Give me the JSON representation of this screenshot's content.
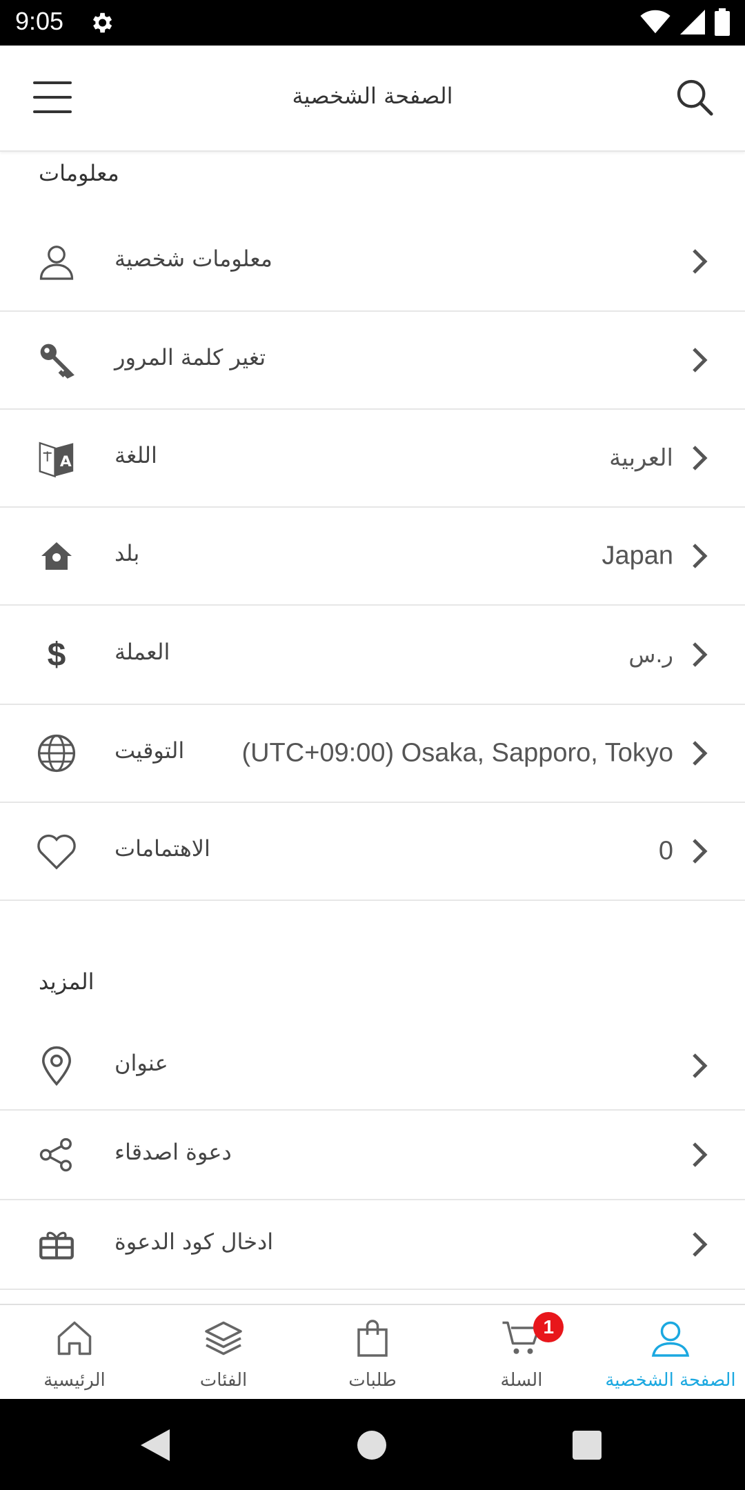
{
  "status": {
    "time": "9:05"
  },
  "header": {
    "title": "الصفحة الشخصية"
  },
  "sections": {
    "info_title": "معلومات",
    "more_title": "المزيد"
  },
  "info_items": [
    {
      "label": "معلومات شخصية",
      "value": "",
      "icon": "user-icon"
    },
    {
      "label": "تغير كلمة المرور",
      "value": "",
      "icon": "key-icon"
    },
    {
      "label": "اللغة",
      "value": "العربية",
      "icon": "translate-icon"
    },
    {
      "label": "بلد",
      "value": "Japan",
      "icon": "home-location-icon"
    },
    {
      "label": "العملة",
      "value": "ر.س",
      "icon": "dollar-icon"
    },
    {
      "label": "التوقيت",
      "value": "(UTC+09:00) Osaka, Sapporo, Tokyo",
      "icon": "globe-icon"
    },
    {
      "label": "الاهتمامات",
      "value": "0",
      "icon": "heart-icon"
    }
  ],
  "more_items": [
    {
      "label": "عنوان",
      "icon": "location-pin-icon"
    },
    {
      "label": "دعوة اصدقاء",
      "icon": "share-icon"
    },
    {
      "label": "ادخال كود الدعوة",
      "icon": "gift-icon"
    }
  ],
  "bottom_nav": [
    {
      "label": "الرئيسية",
      "icon": "home-icon"
    },
    {
      "label": "الفئات",
      "icon": "layers-icon"
    },
    {
      "label": "طلبات",
      "icon": "bag-icon"
    },
    {
      "label": "السلة",
      "icon": "cart-icon",
      "badge": "1"
    },
    {
      "label": "الصفحة الشخصية",
      "icon": "profile-icon",
      "active": true
    }
  ],
  "colors": {
    "accent": "#1ba8e0",
    "badge": "#e8161b",
    "divider": "#e6e6e6"
  }
}
